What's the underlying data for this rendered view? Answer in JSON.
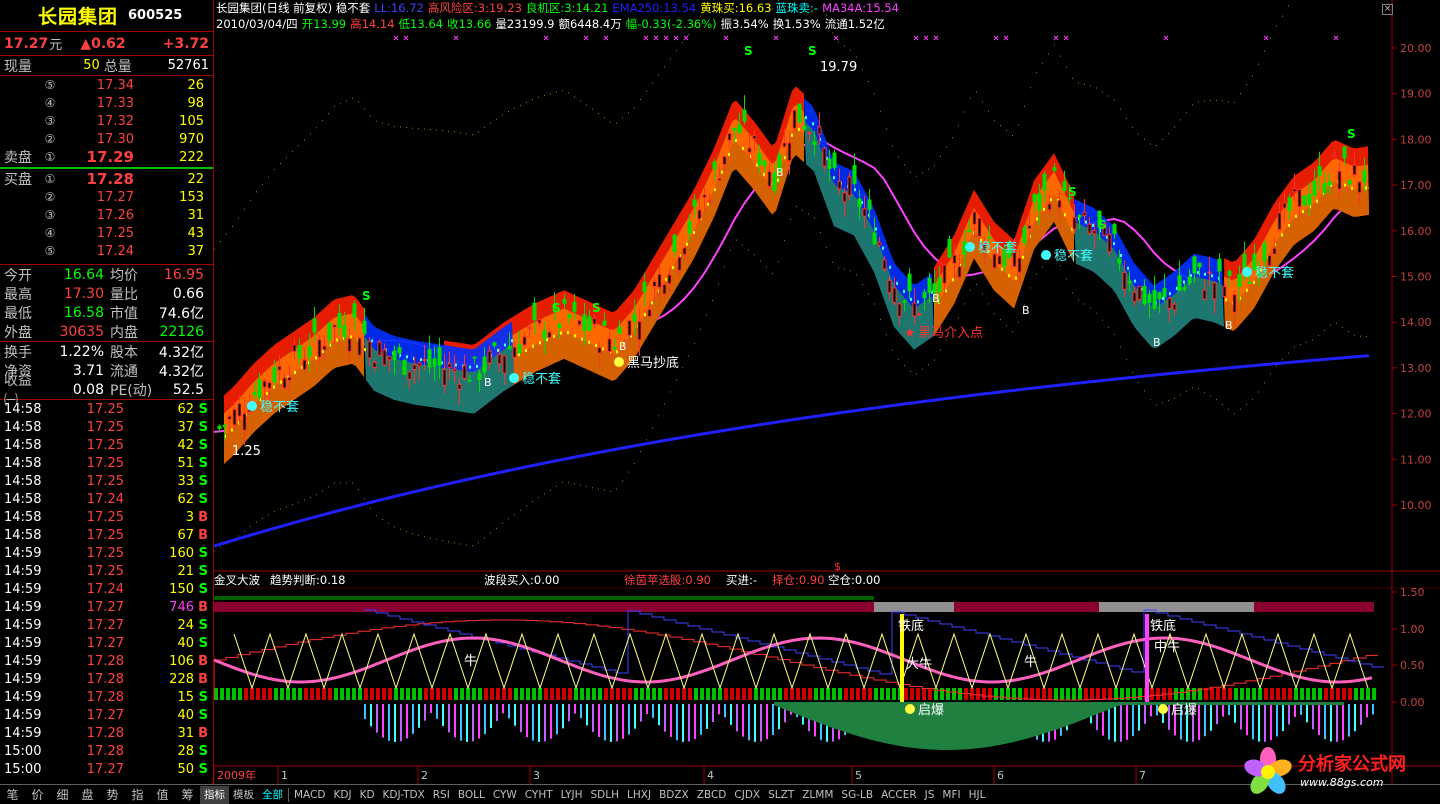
{
  "stock": {
    "name": "长园集团",
    "code": "600525"
  },
  "quote": {
    "price": "17.27",
    "unit": "元",
    "change": "▲0.62",
    "change_pct": "+3.72"
  },
  "volume": {
    "now_label": "现量",
    "now": "50",
    "total_label": "总量",
    "total": "52761"
  },
  "order_book": {
    "sell_label": "卖盘",
    "buy_label": "买盘",
    "asks": [
      {
        "level": "⑤",
        "price": "17.34",
        "vol": "26"
      },
      {
        "level": "④",
        "price": "17.33",
        "vol": "98"
      },
      {
        "level": "③",
        "price": "17.32",
        "vol": "105"
      },
      {
        "level": "②",
        "price": "17.30",
        "vol": "970"
      },
      {
        "level": "①",
        "price": "17.29",
        "vol": "222"
      }
    ],
    "bids": [
      {
        "level": "①",
        "price": "17.28",
        "vol": "22"
      },
      {
        "level": "②",
        "price": "17.27",
        "vol": "153"
      },
      {
        "level": "③",
        "price": "17.26",
        "vol": "31"
      },
      {
        "level": "④",
        "price": "17.25",
        "vol": "43"
      },
      {
        "level": "⑤",
        "price": "17.24",
        "vol": "37"
      }
    ]
  },
  "stats1": [
    {
      "k1": "今开",
      "v1": "16.64",
      "c1": "#00ff00",
      "k2": "均价",
      "v2": "16.95",
      "c2": "#ff4040"
    },
    {
      "k1": "最高",
      "v1": "17.30",
      "c1": "#ff4040",
      "k2": "量比",
      "v2": "0.66",
      "c2": "#ffffff"
    },
    {
      "k1": "最低",
      "v1": "16.58",
      "c1": "#00ff00",
      "k2": "市值",
      "v2": "74.6亿",
      "c2": "#ffffff"
    },
    {
      "k1": "外盘",
      "v1": "30635",
      "c1": "#ff4040",
      "k2": "内盘",
      "v2": "22126",
      "c2": "#00ff00"
    }
  ],
  "stats2": [
    {
      "k1": "换手",
      "v1": "1.22%",
      "c1": "#ffffff",
      "k2": "股本",
      "v2": "4.32亿",
      "c2": "#ffffff"
    },
    {
      "k1": "净资",
      "v1": "3.71",
      "c1": "#ffffff",
      "k2": "流通",
      "v2": "4.32亿",
      "c2": "#ffffff"
    },
    {
      "k1": "收益㈠",
      "v1": "0.08",
      "c1": "#ffffff",
      "k2": "PE(动)",
      "v2": "52.5",
      "c2": "#ffffff"
    }
  ],
  "ticks": [
    {
      "t": "14:58",
      "p": "17.25",
      "v": "62",
      "d": "S"
    },
    {
      "t": "14:58",
      "p": "17.25",
      "v": "37",
      "d": "S"
    },
    {
      "t": "14:58",
      "p": "17.25",
      "v": "42",
      "d": "S"
    },
    {
      "t": "14:58",
      "p": "17.25",
      "v": "51",
      "d": "S"
    },
    {
      "t": "14:58",
      "p": "17.25",
      "v": "33",
      "d": "S"
    },
    {
      "t": "14:58",
      "p": "17.24",
      "v": "62",
      "d": "S"
    },
    {
      "t": "14:58",
      "p": "17.25",
      "v": "3",
      "d": "B"
    },
    {
      "t": "14:58",
      "p": "17.25",
      "v": "67",
      "d": "B"
    },
    {
      "t": "14:59",
      "p": "17.25",
      "v": "160",
      "d": "S"
    },
    {
      "t": "14:59",
      "p": "17.25",
      "v": "21",
      "d": "S"
    },
    {
      "t": "14:59",
      "p": "17.24",
      "v": "150",
      "d": "S"
    },
    {
      "t": "14:59",
      "p": "17.27",
      "v": "746",
      "d": "B"
    },
    {
      "t": "14:59",
      "p": "17.27",
      "v": "24",
      "d": "S"
    },
    {
      "t": "14:59",
      "p": "17.27",
      "v": "40",
      "d": "S"
    },
    {
      "t": "14:59",
      "p": "17.28",
      "v": "106",
      "d": "B"
    },
    {
      "t": "14:59",
      "p": "17.28",
      "v": "228",
      "d": "B"
    },
    {
      "t": "14:59",
      "p": "17.28",
      "v": "15",
      "d": "S"
    },
    {
      "t": "14:59",
      "p": "17.27",
      "v": "40",
      "d": "S"
    },
    {
      "t": "14:59",
      "p": "17.28",
      "v": "31",
      "d": "B"
    },
    {
      "t": "15:00",
      "p": "17.28",
      "v": "28",
      "d": "S"
    },
    {
      "t": "15:00",
      "p": "17.27",
      "v": "50",
      "d": "S"
    }
  ],
  "main_header": {
    "line1": [
      {
        "text": "长园集团(日线 前复权) 稳不套",
        "color": "#ffffff"
      },
      {
        "text": "LL:16.72",
        "color": "#4040ff"
      },
      {
        "text": "高风险区:3:19.23",
        "color": "#ff4040"
      },
      {
        "text": "良机区:3:14.21",
        "color": "#00ff00"
      },
      {
        "text": "EMA250:13.54",
        "color": "#2020ff"
      },
      {
        "text": "黄珠买:16.63",
        "color": "#ffff00"
      },
      {
        "text": "蓝珠卖:-",
        "color": "#00ffff"
      },
      {
        "text": "MA34A:15.54",
        "color": "#ff40ff"
      }
    ],
    "line2": [
      {
        "text": "2010/03/04/四",
        "color": "#ffffff"
      },
      {
        "text": "开13.99",
        "color": "#00ff00"
      },
      {
        "text": "高14.14",
        "color": "#ff4040"
      },
      {
        "text": "低13.64",
        "color": "#00ff00"
      },
      {
        "text": "收13.66",
        "color": "#00ff00"
      },
      {
        "text": "量23199.9",
        "color": "#ffffff"
      },
      {
        "text": "额6448.4万",
        "color": "#ffffff"
      },
      {
        "text": "幅-0.33(-2.36%)",
        "color": "#00ff00"
      },
      {
        "text": "振3.54%",
        "color": "#ffffff"
      },
      {
        "text": "换1.53%",
        "color": "#ffffff"
      },
      {
        "text": "流通1.52亿",
        "color": "#ffffff"
      }
    ]
  },
  "sub_header": [
    {
      "text": "金叉大波",
      "color": "#ffffff"
    },
    {
      "text": "趋势判断:0.18",
      "color": "#ffffff"
    },
    {
      "text": "波段买入:0.00",
      "color": "#ffffff"
    },
    {
      "text": "徐茵苹选股:0.90",
      "color": "#ff4040"
    },
    {
      "text": "买进:-",
      "color": "#ffffff"
    },
    {
      "text": "择仓:0.90",
      "color": "#ff4040"
    },
    {
      "text": "空仓:0.00",
      "color": "#ffffff"
    }
  ],
  "annotations": {
    "wbt": "稳不套",
    "hmcd": "黑马抄底",
    "hmjr": "黑马介入点",
    "low_price": "1.25",
    "high_price": "19.79",
    "tiedi": "铁底",
    "qibao": "启爆",
    "niu": "牛",
    "daniu": "大牛",
    "zhongniu": "中牛",
    "ss": "S",
    "bb": "B"
  },
  "price_axis": [
    "20.00",
    "19.00",
    "18.00",
    "17.00",
    "16.00",
    "15.00",
    "14.00",
    "13.00",
    "12.00",
    "11.00",
    "10.00"
  ],
  "ind_axis": [
    "1.50",
    "1.00",
    "0.50",
    "0.00"
  ],
  "months": [
    {
      "label": "2009年",
      "color": "#ff4040"
    },
    {
      "label": "1",
      "color": "#c0c0c0"
    },
    {
      "label": "2",
      "color": "#c0c0c0"
    },
    {
      "label": "3",
      "color": "#c0c0c0"
    },
    {
      "label": "4",
      "color": "#c0c0c0"
    },
    {
      "label": "5",
      "color": "#c0c0c0"
    },
    {
      "label": "6",
      "color": "#c0c0c0"
    },
    {
      "label": "7",
      "color": "#c0c0c0"
    }
  ],
  "left_tabs": [
    "笔",
    "价",
    "细",
    "盘",
    "势",
    "指",
    "值",
    "筹"
  ],
  "tabs": [
    "指标",
    "模板",
    "全部",
    "MACD",
    "KDJ",
    "KD",
    "KDJ-TDX",
    "RSI",
    "BOLL",
    "CYW",
    "CYHT",
    "LYJH",
    "SDLH",
    "LHXJ",
    "BDZX",
    "ZBCD",
    "CJDX",
    "SLZT",
    "ZLMM",
    "SG-LB",
    "ACCER",
    "JS",
    "MFI",
    "HJL"
  ],
  "watermark": {
    "name": "分析家公式网",
    "url": "www.88gs.com"
  },
  "colors": {
    "up": "#ff4040",
    "down": "#00ff00",
    "grid": "#a00000",
    "ma34": "#ff40ff",
    "ema250": "#2020ff"
  }
}
